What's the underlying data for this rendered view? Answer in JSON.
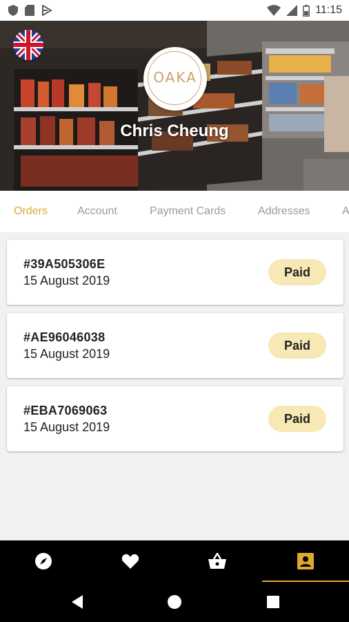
{
  "status_bar": {
    "time": "11:15"
  },
  "header": {
    "user_name": "Chris Cheung",
    "logo_text": "OAKA",
    "language_flag": "uk-flag-icon"
  },
  "tabs": [
    {
      "label": "Orders",
      "active": true
    },
    {
      "label": "Account",
      "active": false
    },
    {
      "label": "Payment Cards",
      "active": false
    },
    {
      "label": "Addresses",
      "active": false
    },
    {
      "label": "A",
      "active": false
    }
  ],
  "orders": [
    {
      "id": "#39A505306E",
      "date": "15 August 2019",
      "status": "Paid"
    },
    {
      "id": "#AE96046038",
      "date": "15 August 2019",
      "status": "Paid"
    },
    {
      "id": "#EBA7069063",
      "date": "15 August 2019",
      "status": "Paid"
    }
  ],
  "bottom_nav": [
    {
      "icon": "compass-icon",
      "active": false
    },
    {
      "icon": "heart-icon",
      "active": false
    },
    {
      "icon": "basket-icon",
      "active": false
    },
    {
      "icon": "account-box-icon",
      "active": true
    }
  ],
  "colors": {
    "accent": "#e0a82e",
    "badge_bg": "#f7e8b5",
    "background": "#f1f1f1"
  }
}
